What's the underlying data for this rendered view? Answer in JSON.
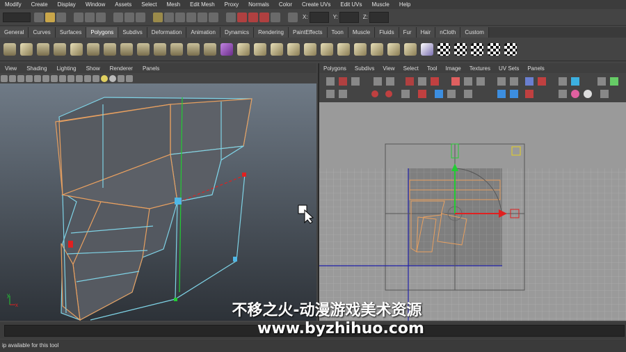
{
  "menubar": [
    "Modify",
    "Create",
    "Display",
    "Window",
    "Assets",
    "Select",
    "Mesh",
    "Edit Mesh",
    "Proxy",
    "Normals",
    "Color",
    "Create UVs",
    "Edit UVs",
    "Muscle",
    "Help"
  ],
  "statusline": {
    "mode_value": "",
    "x_label": "X:",
    "y_label": "Y:",
    "z_label": "Z:"
  },
  "shelf_tabs": [
    "General",
    "Curves",
    "Surfaces",
    "Polygons",
    "Subdivs",
    "Deformation",
    "Animation",
    "Dynamics",
    "Rendering",
    "PaintEffects",
    "Toon",
    "Muscle",
    "Fluids",
    "Fur",
    "Hair",
    "nCloth",
    "Custom"
  ],
  "active_shelf_tab": "Polygons",
  "viewport_menu": [
    "View",
    "Shading",
    "Lighting",
    "Show",
    "Renderer",
    "Panels"
  ],
  "uv_menu": [
    "Polygons",
    "Subdivs",
    "View",
    "Select",
    "Tool",
    "Image",
    "Textures",
    "UV Sets",
    "Panels"
  ],
  "axis_labels": {
    "y": "y",
    "x": "x"
  },
  "help_line": "ip available for this tool",
  "watermark": {
    "title": "不移之火-动漫游戏美术资源",
    "url": "www.byzhihuo.com"
  },
  "colors": {
    "wireframe_orange": "#e8a060",
    "wireframe_cyan": "#7fd3e6",
    "manip_green": "#22cc33",
    "manip_red": "#e02020",
    "accent_yellow": "#e6d020"
  }
}
